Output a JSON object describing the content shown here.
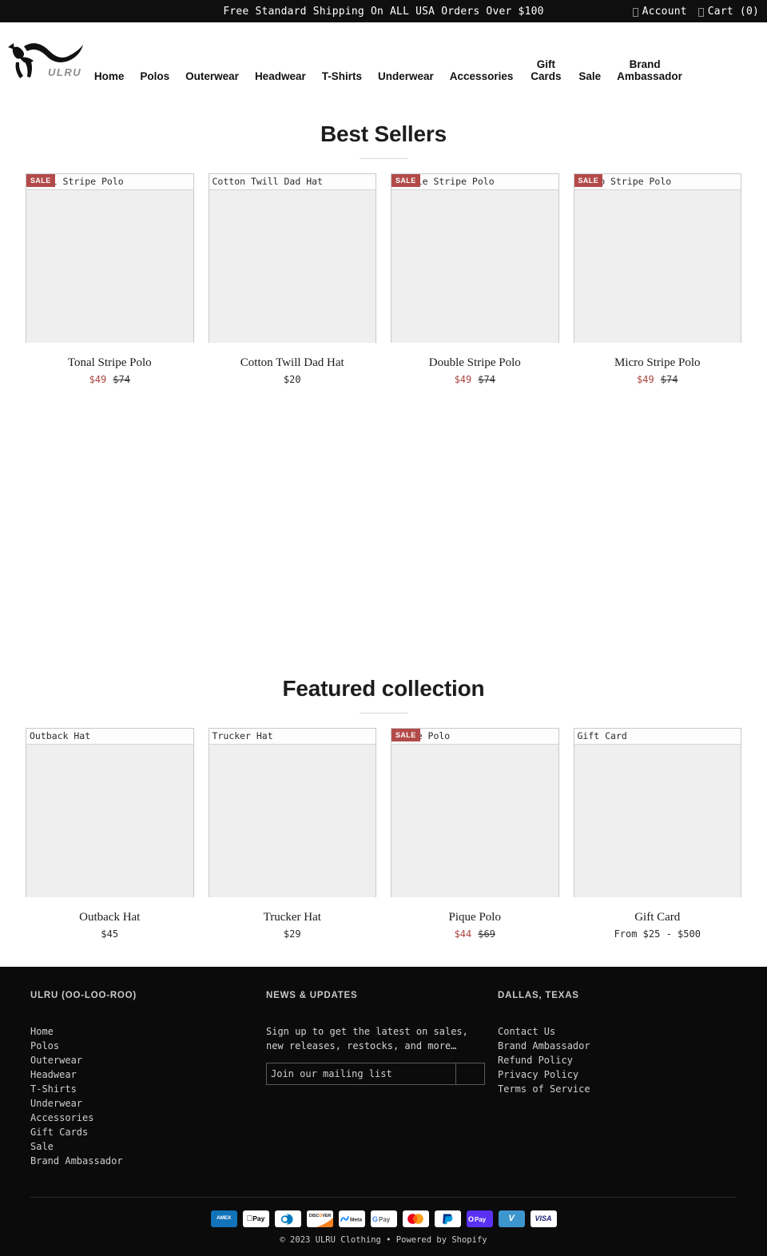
{
  "announcement": {
    "message": "Free Standard Shipping On ALL USA Orders Over $100",
    "account_label": "Account",
    "account_icon": "user-icon",
    "cart_label": "Cart (0)",
    "cart_icon": "shopping-cart-icon"
  },
  "header": {
    "logo_text": "ULRU",
    "logo_icon": "kangaroo-logo"
  },
  "nav": {
    "items": [
      {
        "label": "Home"
      },
      {
        "label": "Polos"
      },
      {
        "label": "Outerwear"
      },
      {
        "label": "Headwear"
      },
      {
        "label": "T-Shirts"
      },
      {
        "label": "Underwear"
      },
      {
        "label": "Accessories"
      },
      {
        "label": "Gift Cards"
      },
      {
        "label": "Sale"
      },
      {
        "label": "Brand Ambassador"
      }
    ]
  },
  "sections": [
    {
      "title": "Best Sellers",
      "products": [
        {
          "alt_text": "Tonal Stripe Polo",
          "title": "Tonal Stripe Polo",
          "price": "$49",
          "compare_price": "$74",
          "on_sale": true,
          "badge": "SALE"
        },
        {
          "alt_text": "Cotton Twill Dad Hat",
          "title": "Cotton Twill Dad Hat",
          "price": "$20",
          "compare_price": "",
          "on_sale": false,
          "badge": ""
        },
        {
          "alt_text": "Double Stripe Polo",
          "title": "Double Stripe Polo",
          "price": "$49",
          "compare_price": "$74",
          "on_sale": true,
          "badge": "SALE"
        },
        {
          "alt_text": "Micro Stripe Polo",
          "title": "Micro Stripe Polo",
          "price": "$49",
          "compare_price": "$74",
          "on_sale": true,
          "badge": "SALE"
        }
      ]
    },
    {
      "title": "Featured collection",
      "products": [
        {
          "alt_text": "Outback Hat",
          "title": "Outback Hat",
          "price": "$45",
          "compare_price": "",
          "on_sale": false,
          "badge": ""
        },
        {
          "alt_text": "Trucker Hat",
          "title": "Trucker Hat",
          "price": "$29",
          "compare_price": "",
          "on_sale": false,
          "badge": ""
        },
        {
          "alt_text": "Pique Polo",
          "title": "Pique Polo",
          "price": "$44",
          "compare_price": "$69",
          "on_sale": true,
          "badge": "SALE"
        },
        {
          "alt_text": "Gift Card",
          "title": "Gift Card",
          "price": "From $25 - $500",
          "compare_price": "",
          "on_sale": false,
          "badge": ""
        }
      ]
    }
  ],
  "footer": {
    "col1": {
      "heading": "ULRU (OO-LOO-ROO)",
      "links": [
        "Home",
        "Polos",
        "Outerwear",
        "Headwear",
        "T-Shirts",
        "Underwear",
        "Accessories",
        "Gift Cards",
        "Sale",
        "Brand Ambassador"
      ]
    },
    "col2": {
      "heading": "NEWS & UPDATES",
      "description": "Sign up to get the latest on sales, new releases, restocks, and more…",
      "input_placeholder": "Join our mailing list",
      "input_value": "",
      "submit_icon": "submit-arrow-icon"
    },
    "col3": {
      "heading": "DALLAS, TEXAS",
      "links": [
        "Contact Us",
        "Brand Ambassador",
        "Refund Policy",
        "Privacy Policy",
        "Terms of Service"
      ]
    },
    "payment_methods": [
      {
        "name": "american-express",
        "label": "AMEX"
      },
      {
        "name": "apple-pay",
        "label": "Pay"
      },
      {
        "name": "diners-club",
        "label": ""
      },
      {
        "name": "discover",
        "label": "DISCOVER"
      },
      {
        "name": "meta-pay",
        "label": "Meta"
      },
      {
        "name": "google-pay",
        "label": "Pay"
      },
      {
        "name": "mastercard",
        "label": ""
      },
      {
        "name": "paypal",
        "label": ""
      },
      {
        "name": "shop-pay",
        "label": "Pay"
      },
      {
        "name": "venmo",
        "label": "V"
      },
      {
        "name": "visa",
        "label": "VISA"
      }
    ],
    "copyright": "© 2023 ULRU Clothing • Powered by Shopify"
  },
  "colors": {
    "sale_badge": "#b34a4a",
    "sale_price": "#a8443f",
    "footer_bg": "#0b0b0b",
    "announce_bg": "#0f0f0f",
    "shop_pay": "#5a31f4",
    "venmo": "#3d95ce"
  }
}
